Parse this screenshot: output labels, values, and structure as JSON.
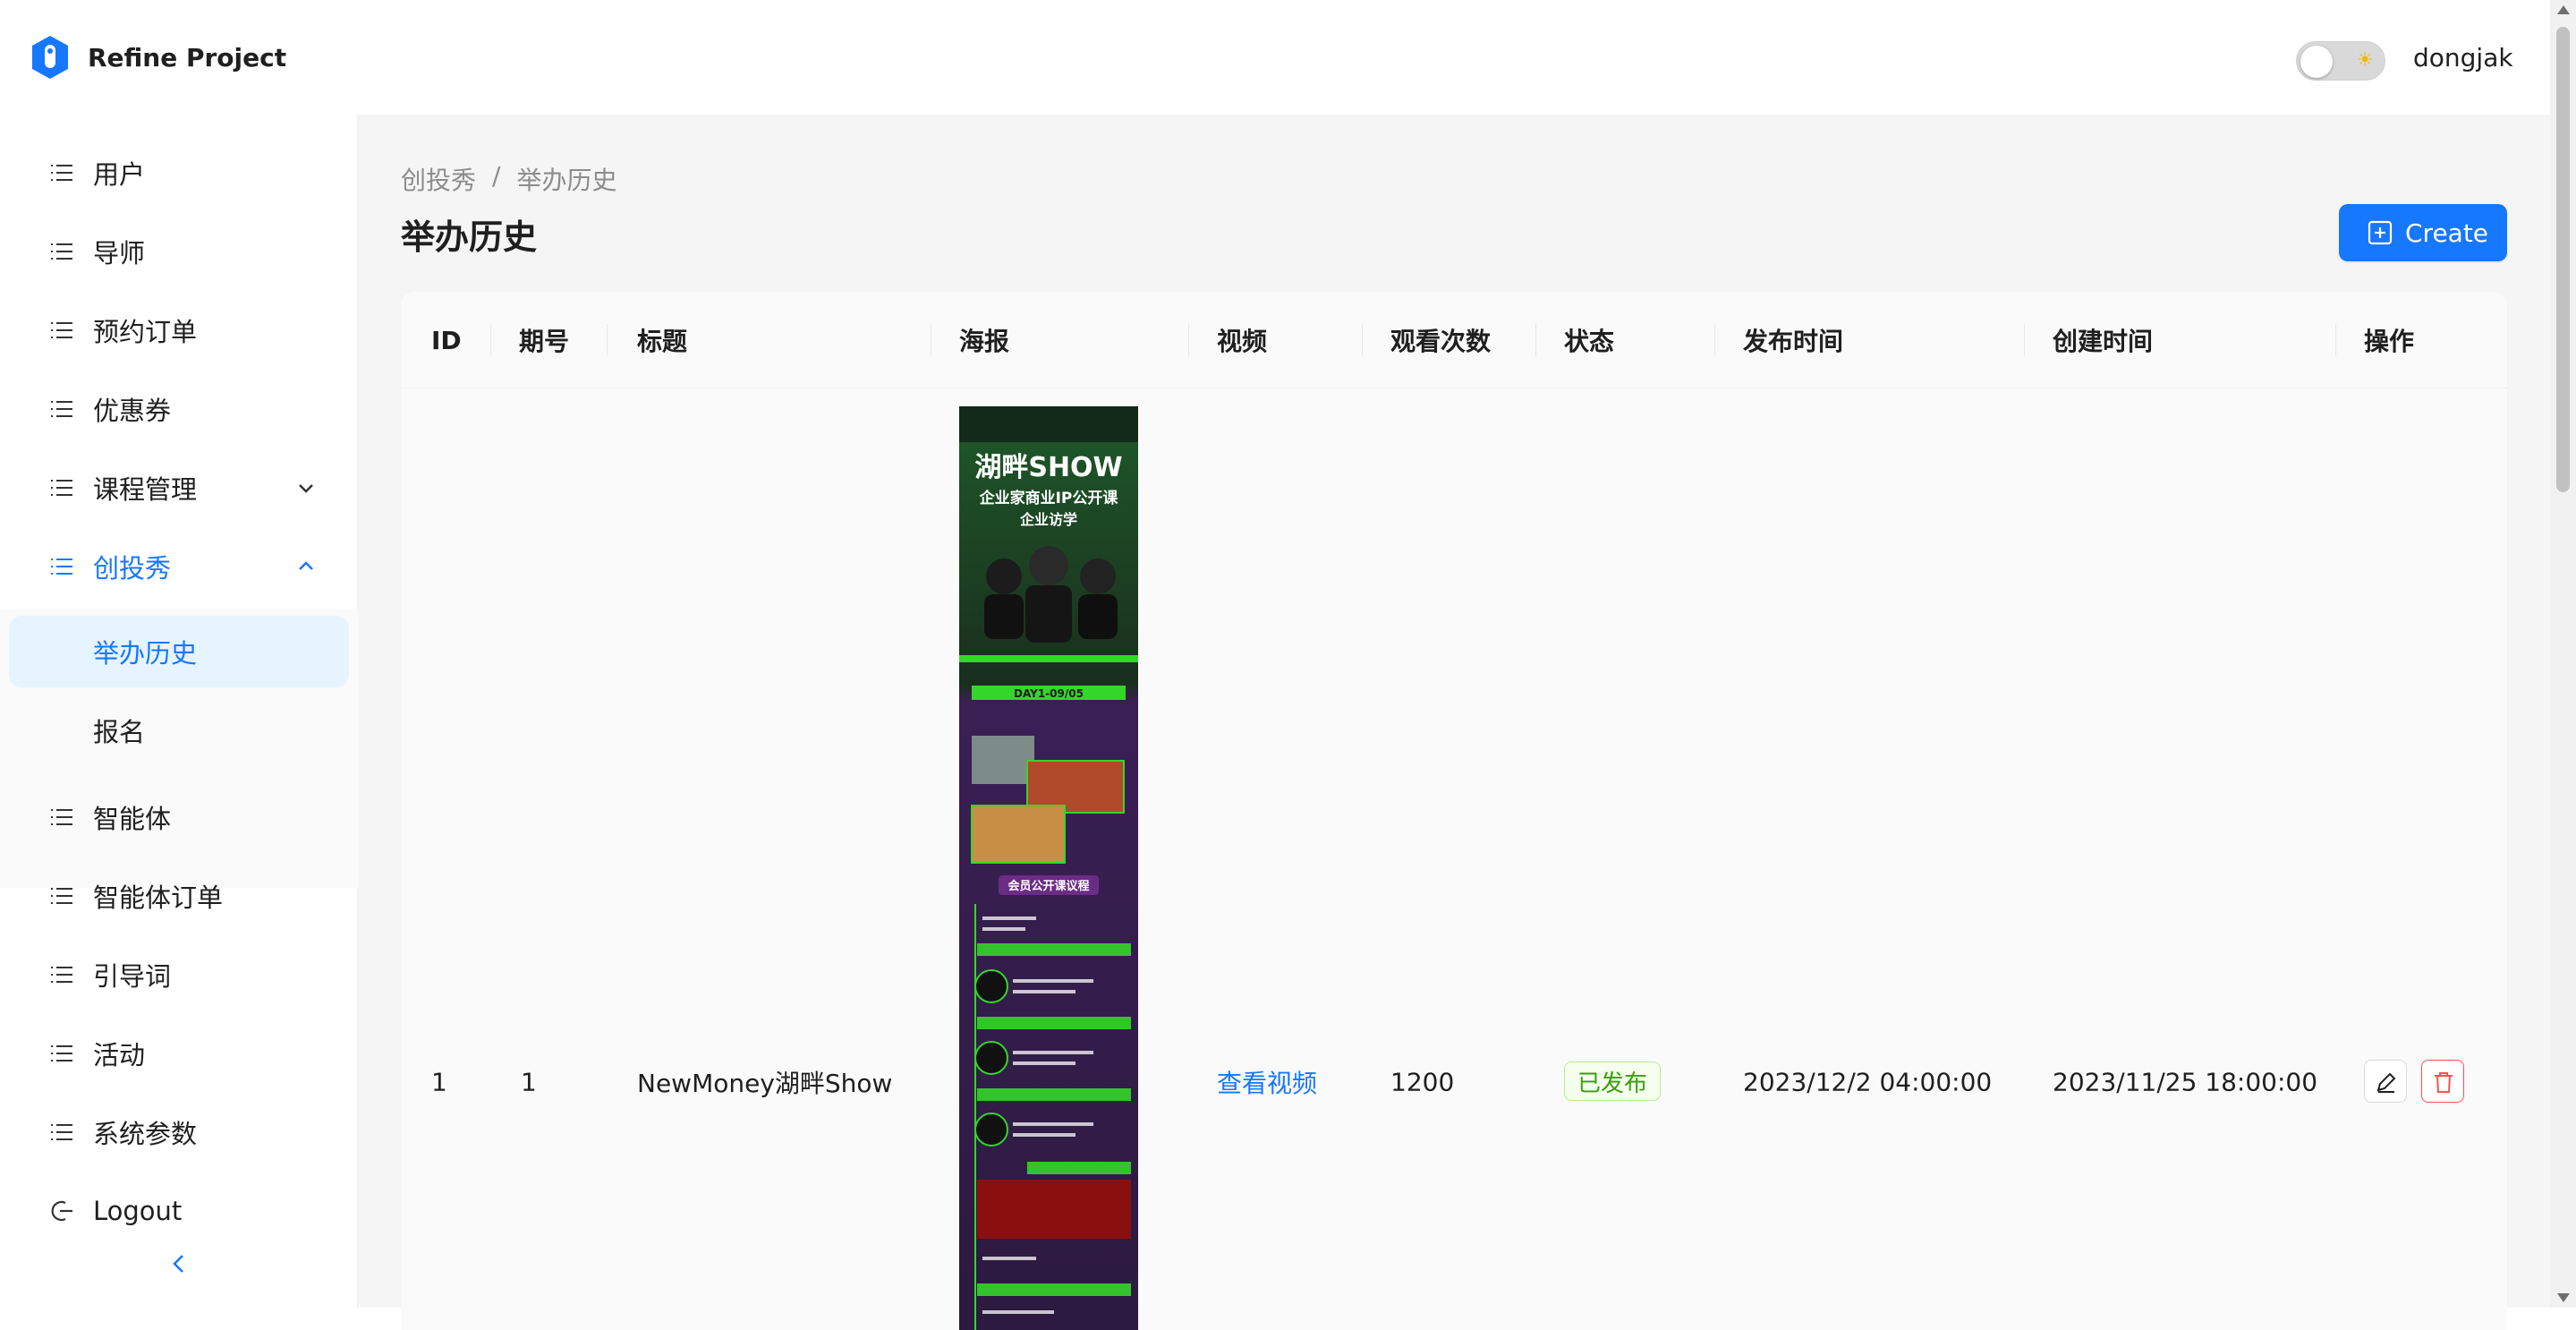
{
  "app": {
    "title": "Refine Project"
  },
  "header": {
    "user_name": "dongjak",
    "theme_toggle_icon": "sun-icon"
  },
  "sidebar": {
    "items": [
      {
        "label": "用户"
      },
      {
        "label": "导师"
      },
      {
        "label": "预约订单"
      },
      {
        "label": "优惠券"
      },
      {
        "label": "课程管理"
      },
      {
        "label": "创投秀"
      },
      {
        "label": "智能体"
      },
      {
        "label": "智能体订单"
      },
      {
        "label": "引导词"
      },
      {
        "label": "活动"
      },
      {
        "label": "系统参数"
      },
      {
        "label": "Logout"
      }
    ],
    "submenu": [
      {
        "label": "举办历史"
      },
      {
        "label": "报名"
      }
    ]
  },
  "breadcrumb": {
    "parent": "创投秀",
    "separator": "/",
    "current": "举办历史"
  },
  "page": {
    "title": "举办历史",
    "create_label": "Create"
  },
  "table": {
    "columns": [
      "ID",
      "期号",
      "标题",
      "海报",
      "视频",
      "观看次数",
      "状态",
      "发布时间",
      "创建时间",
      "操作"
    ],
    "rows": [
      {
        "id": "1",
        "issue": "1",
        "title": "NewMoney湖畔Show",
        "video": "查看视频",
        "views": "1200",
        "status": "已发布",
        "published_at": "2023/12/2 04:00:00",
        "created_at": "2023/11/25 18:00:00"
      }
    ]
  },
  "poster": {
    "title": "湖畔SHOW",
    "subtitle": "企业家商业IP公开课",
    "subtitle2": "企业访学",
    "day_banner": "DAY1-09/05",
    "section": "会员公开课议程"
  },
  "colors": {
    "accent": "#1677ff",
    "danger": "#ff4d4f",
    "success": "#389e0d",
    "poster_green": "#35d62a"
  }
}
